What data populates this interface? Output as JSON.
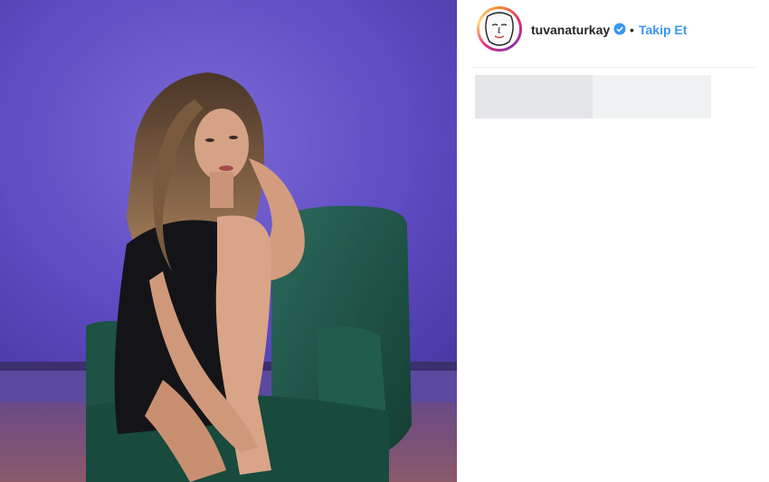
{
  "post": {
    "photo_icon": "portrait-photo",
    "username": "tuvanaturkay",
    "verified_icon": "verified-badge-icon",
    "separator": "•",
    "follow_label": "Takip Et"
  },
  "colors": {
    "follow": "#3897f0",
    "background_wall": "#6a55c9",
    "chair": "#1f5246",
    "verified": "#3897f0"
  }
}
